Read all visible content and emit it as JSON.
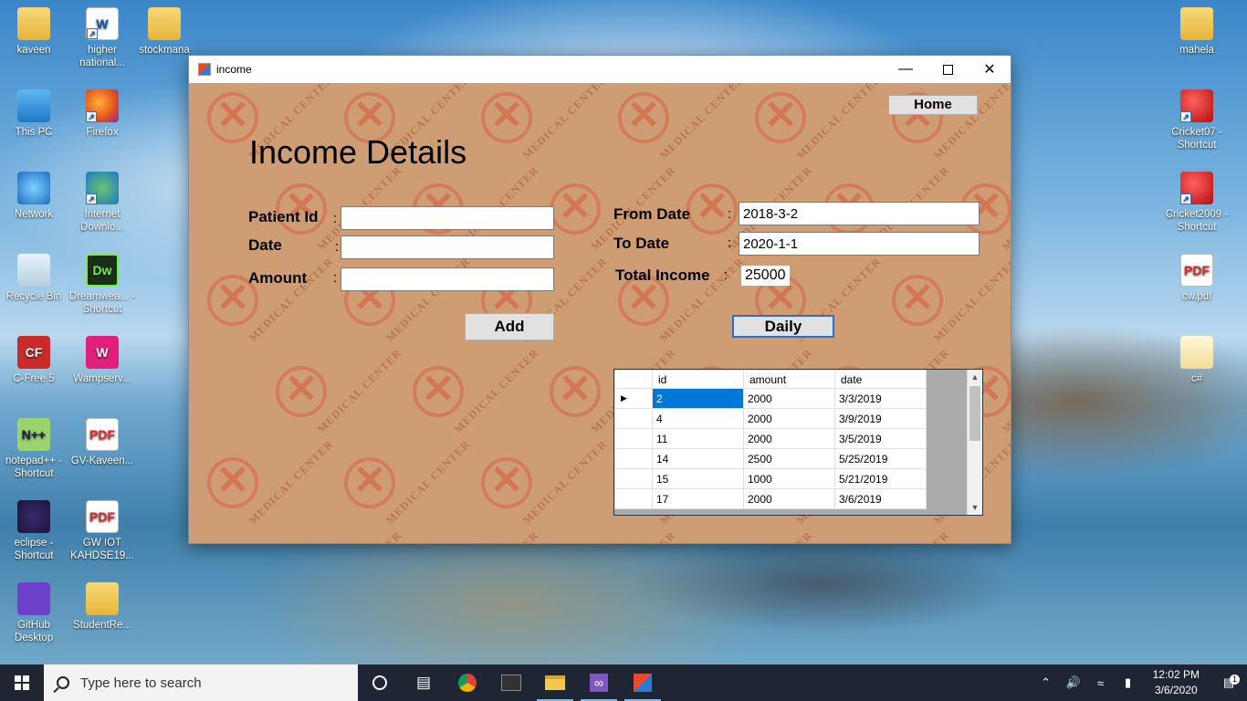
{
  "desktop": {
    "left_icons": [
      {
        "label": "kaveen",
        "glyph": "☺"
      },
      {
        "label": "higher national...",
        "glyph": "W"
      },
      {
        "label": "stockmana",
        "glyph": "■"
      },
      {
        "label": "This PC",
        "glyph": "□"
      },
      {
        "label": "Firefox",
        "glyph": ""
      },
      {
        "label": "Network",
        "glyph": "○"
      },
      {
        "label": "Internet Downlo...",
        "glyph": ""
      },
      {
        "label": "Recycle Bin",
        "glyph": "♻"
      },
      {
        "label": "Dreamwea... - Shortcut",
        "glyph": "Dw"
      },
      {
        "label": "C-Free 5",
        "glyph": "CF"
      },
      {
        "label": "Wampserv...",
        "glyph": "W"
      },
      {
        "label": "notepad++ - Shortcut",
        "glyph": "N"
      },
      {
        "label": "GV-Kaveen...",
        "glyph": "PDF"
      },
      {
        "label": "eclipse - Shortcut",
        "glyph": "◑"
      },
      {
        "label": "GW IOT KAHDSE19...",
        "glyph": "PDF"
      },
      {
        "label": "GitHub Desktop",
        "glyph": "◉"
      },
      {
        "label": "StudentRe...",
        "glyph": ""
      }
    ],
    "right_icons": [
      {
        "label": "mahela",
        "glyph": ""
      },
      {
        "label": "Cricket07 - Shortcut",
        "glyph": "C"
      },
      {
        "label": "Cricket2009 - Shortcut",
        "glyph": "C"
      },
      {
        "label": "cw.pdf",
        "glyph": "PDF"
      },
      {
        "label": "c#",
        "glyph": ""
      }
    ]
  },
  "window": {
    "title": "income",
    "minimize": "—",
    "close": "✕",
    "home_button": "Home",
    "heading": "Income Details",
    "colon": ":",
    "form": {
      "patient_id_label": "Patient Id",
      "patient_id_value": "",
      "date_label": "Date",
      "date_value": "",
      "amount_label": "Amount",
      "amount_value": "",
      "add_button": "Add"
    },
    "report": {
      "from_date_label": "From Date",
      "from_date_value": "2018-3-2",
      "to_date_label": "To Date",
      "to_date_value": "2020-1-1",
      "total_income_label": "Total Income",
      "total_income_value": "25000",
      "daily_button": "Daily"
    },
    "grid": {
      "columns": [
        "id",
        "amount",
        "date"
      ],
      "row_marker": "▶",
      "rows": [
        [
          "2",
          "2000",
          "3/3/2019"
        ],
        [
          "4",
          "2000",
          "3/9/2019"
        ],
        [
          "11",
          "2000",
          "3/5/2019"
        ],
        [
          "14",
          "2500",
          "5/25/2019"
        ],
        [
          "15",
          "1000",
          "5/21/2019"
        ],
        [
          "17",
          "2000",
          "3/6/2019"
        ]
      ]
    },
    "watermark": {
      "text": "MEDICAL CENTER",
      "mark": "✕"
    }
  },
  "taskbar": {
    "search_placeholder": "Type here to search",
    "time": "12:02 PM",
    "date": "3/6/2020",
    "notification_count": "1"
  }
}
